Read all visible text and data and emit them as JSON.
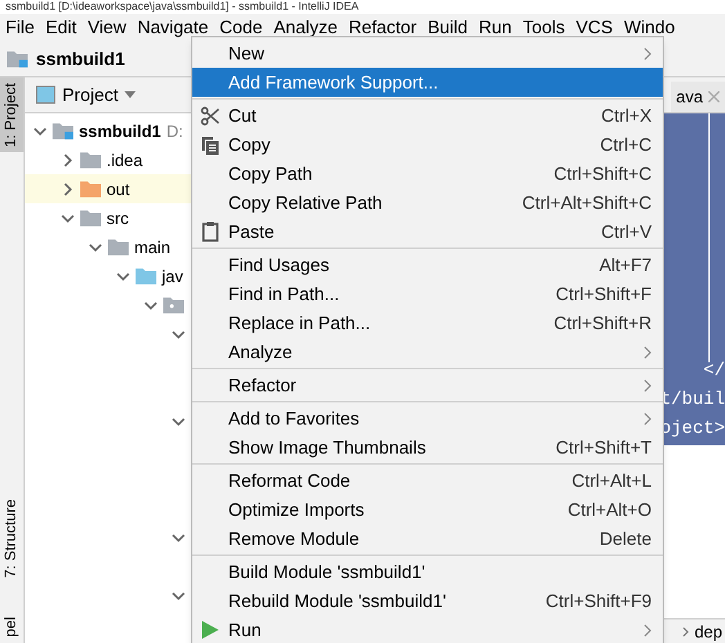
{
  "window": {
    "title": "ssmbuild1 [D:\\ideaworkspace\\java\\ssmbuild1] - ssmbuild1 - IntelliJ IDEA"
  },
  "menu_bar": [
    "File",
    "Edit",
    "View",
    "Navigate",
    "Code",
    "Analyze",
    "Refactor",
    "Build",
    "Run",
    "Tools",
    "VCS",
    "Windo"
  ],
  "navigation_bar": {
    "project": "ssmbuild1"
  },
  "side_tabs": [
    {
      "label": "1: Project",
      "selected": true
    },
    {
      "label": "7: Structure",
      "selected": false
    },
    {
      "label": "pel",
      "selected": false
    }
  ],
  "project_panel": {
    "title": "Project",
    "tree": [
      {
        "label": "ssmbuild1",
        "path": "D:",
        "kind": "module",
        "expanded": true,
        "selected": false,
        "children": [
          {
            "label": ".idea",
            "kind": "folder",
            "expanded": false,
            "selected": false
          },
          {
            "label": "out",
            "kind": "output",
            "expanded": false,
            "selected": true
          },
          {
            "label": "src",
            "kind": "folder",
            "expanded": true,
            "selected": false,
            "children": [
              {
                "label": "main",
                "kind": "folder",
                "expanded": true,
                "selected": false,
                "children": [
                  {
                    "label": "jav",
                    "kind": "source",
                    "expanded": true,
                    "selected": false,
                    "children": [
                      {
                        "kind": "package",
                        "expanded": true,
                        "selected": false,
                        "children": [
                          {
                            "kind": "covered_folder",
                            "expanded": true,
                            "selected": false
                          },
                          {
                            "kind": "covered"
                          },
                          {
                            "kind": "covered"
                          },
                          {
                            "kind": "covered_folder",
                            "expanded": true,
                            "selected": false
                          },
                          {
                            "kind": "covered"
                          },
                          {
                            "kind": "covered"
                          },
                          {
                            "kind": "covered"
                          },
                          {
                            "kind": "covered_folder",
                            "expanded": true,
                            "selected": false
                          },
                          {
                            "kind": "covered"
                          },
                          {
                            "kind": "covered_folder",
                            "expanded": true,
                            "selected": false
                          }
                        ]
                      }
                    ]
                  }
                ]
              }
            ]
          }
        ]
      }
    ]
  },
  "editor": {
    "tab": "ava",
    "lines": [
      "</",
      "t/buil",
      "oject>"
    ],
    "breadcrumb": "dep"
  },
  "context_menu": {
    "groups": [
      [
        {
          "label": "New",
          "submenu": true,
          "selected": false
        },
        {
          "label": "Add Framework Support...",
          "selected": true
        }
      ],
      [
        {
          "label": "Cut",
          "shortcut": "Ctrl+X",
          "selected": false
        },
        {
          "label": "Copy",
          "shortcut": "Ctrl+C",
          "selected": false
        },
        {
          "label": "Copy Path",
          "shortcut": "Ctrl+Shift+C",
          "selected": false
        },
        {
          "label": "Copy Relative Path",
          "shortcut": "Ctrl+Alt+Shift+C",
          "selected": false
        },
        {
          "label": "Paste",
          "shortcut": "Ctrl+V",
          "selected": false
        }
      ],
      [
        {
          "label": "Find Usages",
          "shortcut": "Alt+F7",
          "selected": false
        },
        {
          "label": "Find in Path...",
          "shortcut": "Ctrl+Shift+F",
          "selected": false
        },
        {
          "label": "Replace in Path...",
          "shortcut": "Ctrl+Shift+R",
          "selected": false
        },
        {
          "label": "Analyze",
          "submenu": true,
          "selected": false
        }
      ],
      [
        {
          "label": "Refactor",
          "submenu": true,
          "selected": false
        }
      ],
      [
        {
          "label": "Add to Favorites",
          "submenu": true,
          "selected": false
        },
        {
          "label": "Show Image Thumbnails",
          "shortcut": "Ctrl+Shift+T",
          "selected": false
        }
      ],
      [
        {
          "label": "Reformat Code",
          "shortcut": "Ctrl+Alt+L",
          "selected": false
        },
        {
          "label": "Optimize Imports",
          "shortcut": "Ctrl+Alt+O",
          "selected": false
        },
        {
          "label": "Remove Module",
          "shortcut": "Delete",
          "selected": false
        }
      ],
      [
        {
          "label": "Build Module 'ssmbuild1'",
          "selected": false
        },
        {
          "label": "Rebuild Module 'ssmbuild1'",
          "shortcut": "Ctrl+Shift+F9",
          "selected": false
        },
        {
          "label": "Run",
          "submenu": true,
          "selected": false
        }
      ]
    ]
  }
}
